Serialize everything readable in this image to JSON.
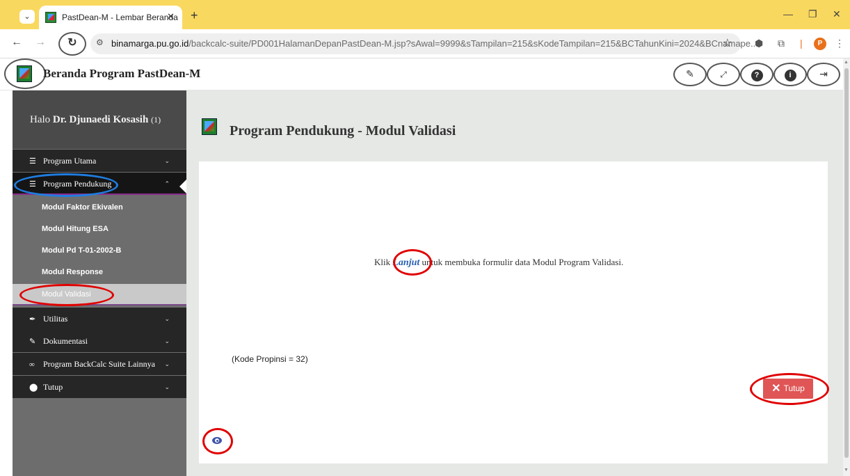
{
  "browser": {
    "tab_title": "PastDean-M - Lembar Beranda",
    "tab_close": "✕",
    "new_tab": "+",
    "url_host": "binamarga.pu.go.id",
    "url_path": "/backcalc-suite/PD001HalamanDepanPastDean-M.jsp?sAwal=9999&sTampilan=215&sKodeTampilan=215&BCTahunKini=2024&BCnamape...",
    "profile_initial": "P"
  },
  "app": {
    "title": "Beranda Program PastDean-M",
    "toolbar_icons": [
      "pencil-icon",
      "expand-icon",
      "help-icon",
      "info-icon",
      "logout-icon"
    ]
  },
  "sidebar": {
    "greeting_prefix": "Halo ",
    "user_name": "Dr. Djunaedi Kosasih",
    "user_count": "(1)",
    "menu": [
      {
        "label": "Program Utama",
        "icon": "list-icon"
      },
      {
        "label": "Program Pendukung",
        "icon": "list-icon"
      },
      {
        "label": "Utilitas",
        "icon": "feather-icon"
      },
      {
        "label": "Dokumentasi",
        "icon": "pencil-icon"
      },
      {
        "label": "Program BackCalc Suite Lainnya",
        "icon": "link-icon"
      },
      {
        "label": "Tutup",
        "icon": "circle-icon"
      }
    ],
    "submenu": [
      "Modul Faktor Ekivalen",
      "Modul Hitung ESA",
      "Modul Pd T-01-2002-B",
      "Modul Response",
      "Modul Validasi"
    ]
  },
  "main": {
    "page_title": "Program Pendukung - Modul Validasi",
    "instruction_prefix": "Klik ",
    "instruction_link": "Lanjut",
    "instruction_suffix": " untuk membuka formulir data Modul Program Validasi.",
    "kode_propinsi": "(Kode Propinsi = 32)",
    "close_button": "Tutup"
  },
  "colors": {
    "tabbar": "#f9d85f",
    "sidebar_dark": "#262626",
    "sidebar_bg": "#6d6d6d",
    "button_red": "#e05555",
    "link_blue": "#2a5fb0",
    "highlight_red": "#e00000",
    "highlight_blue": "#1f7de0"
  }
}
